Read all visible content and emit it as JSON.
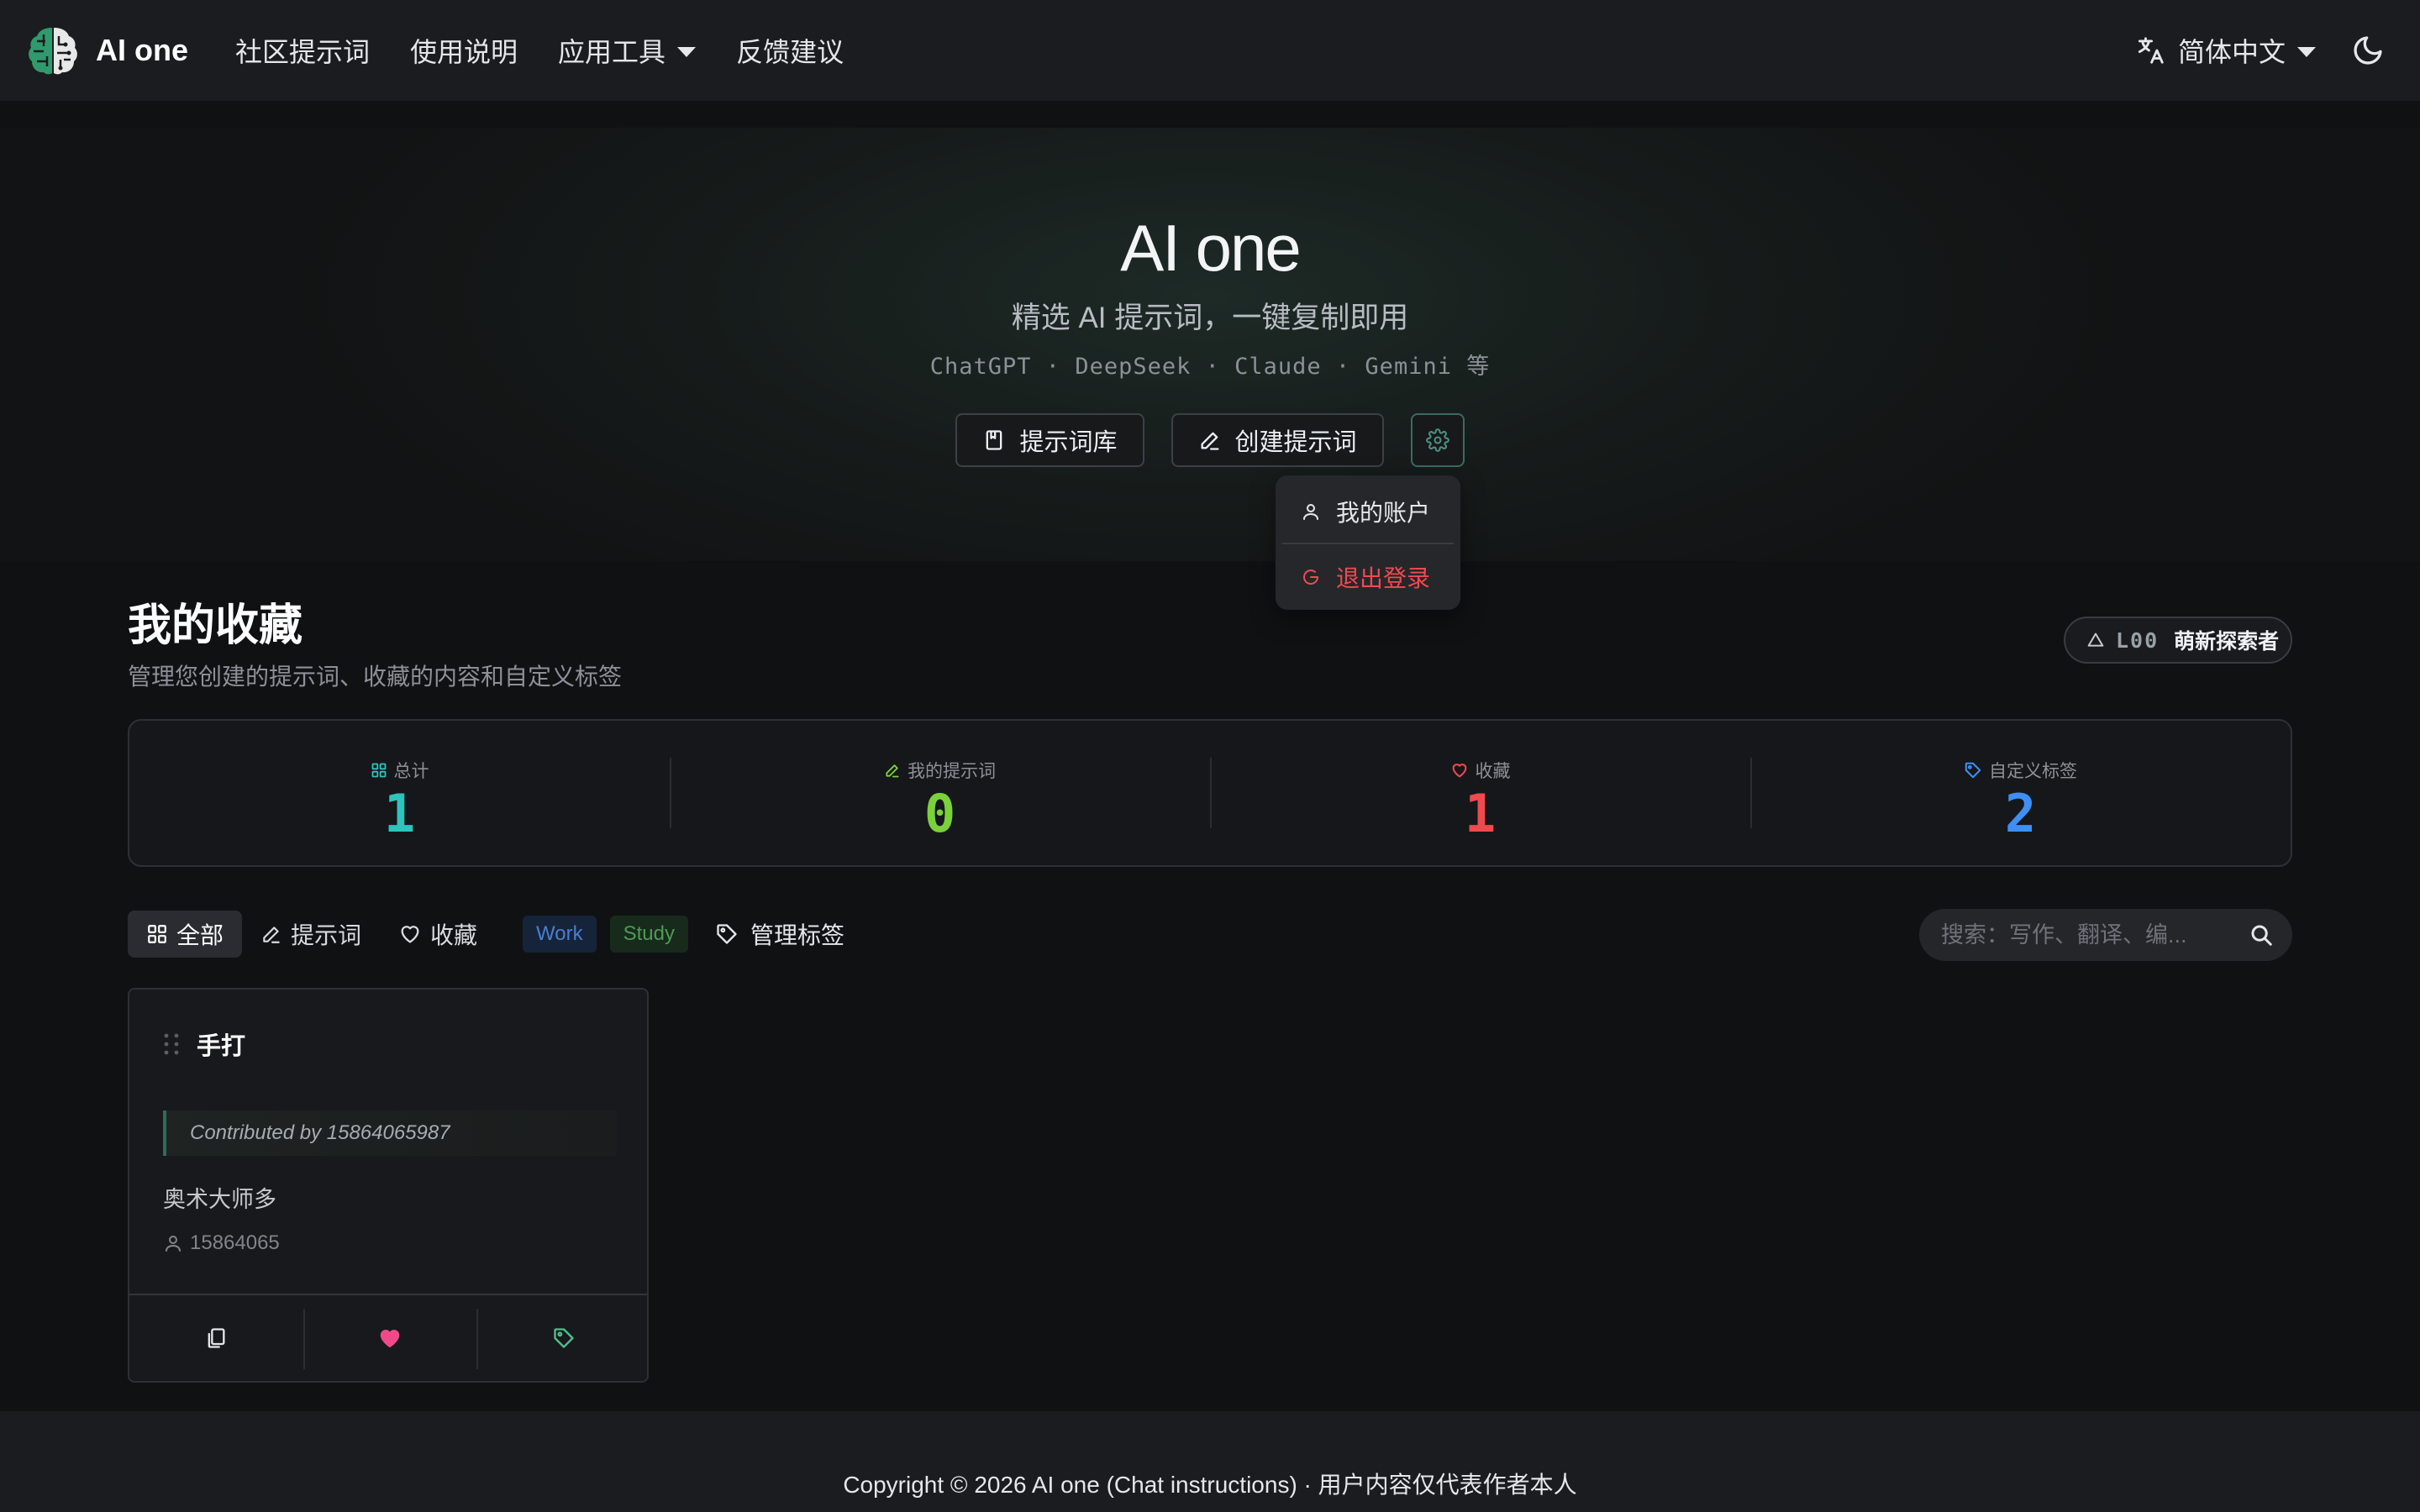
{
  "brand": {
    "name": "AI one"
  },
  "nav": {
    "links": [
      "社区提示词",
      "使用说明",
      "应用工具",
      "反馈建议"
    ],
    "language": "简体中文"
  },
  "hero": {
    "title": "AI one",
    "subtitle": "精选 AI 提示词，一键复制即用",
    "models": "ChatGPT · DeepSeek · Claude · Gemini 等",
    "library_button": "提示词库",
    "create_button": "创建提示词"
  },
  "user_menu": {
    "account": "我的账户",
    "logout": "退出登录"
  },
  "section": {
    "title": "我的收藏",
    "description": "管理您创建的提示词、收藏的内容和自定义标签",
    "level_code": "L00",
    "level_name": "萌新探索者"
  },
  "stats": [
    {
      "label": "总计",
      "value": "1",
      "color": "#2cc4bd",
      "icon": "grid-icon"
    },
    {
      "label": "我的提示词",
      "value": "0",
      "color": "#7bd13a",
      "icon": "pencil-icon"
    },
    {
      "label": "收藏",
      "value": "1",
      "color": "#ef4a4f",
      "icon": "heart-icon"
    },
    {
      "label": "自定义标签",
      "value": "2",
      "color": "#3d8ff5",
      "icon": "tag-icon"
    }
  ],
  "filters": {
    "all": "全部",
    "prompts": "提示词",
    "favorites": "收藏",
    "tags": [
      "Work",
      "Study"
    ],
    "manage": "管理标签",
    "search_placeholder": "搜索：写作、翻译、编..."
  },
  "card": {
    "title": "手打",
    "contributor": "Contributed by 15864065987",
    "description": "奥术大师多",
    "author": "15864065"
  },
  "footer": {
    "text": "Copyright © 2026 AI one (Chat instructions) · 用户内容仅代表作者本人"
  },
  "colors": {
    "accent": "#3b6b5e",
    "danger": "#ef4a4f",
    "heart": "#f0498a"
  }
}
